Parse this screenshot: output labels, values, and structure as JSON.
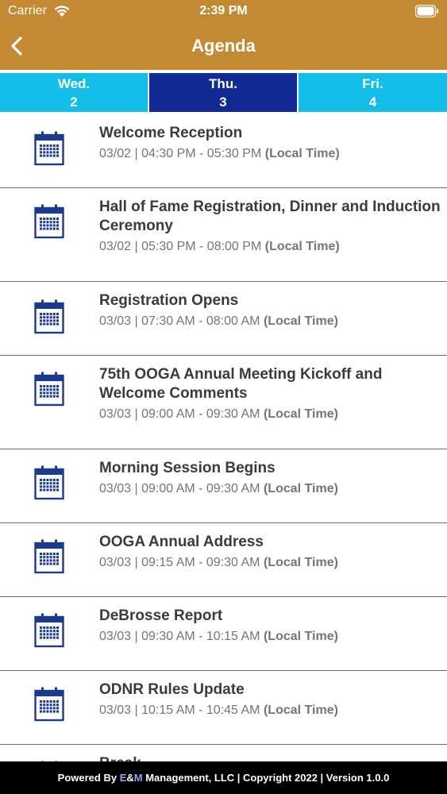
{
  "status": {
    "carrier": "Carrier",
    "time": "2:39 PM"
  },
  "nav": {
    "title": "Agenda",
    "back_icon": "chevron-left-icon"
  },
  "colors": {
    "header": "#c48a33",
    "tab_inactive": "#12bde8",
    "tab_active": "#102b96",
    "calendar_icon": "#1c3a8f"
  },
  "tabs": [
    {
      "day": "Wed.",
      "date": "2"
    },
    {
      "day": "Thu.",
      "date": "3"
    },
    {
      "day": "Fri.",
      "date": "4"
    }
  ],
  "items": [
    {
      "title": "Welcome Reception",
      "time": "03/02 | 04:30 PM - 05:30 PM",
      "zone": "(Local Time)"
    },
    {
      "title": "Hall of Fame Registration, Dinner and Induction Ceremony",
      "time": "03/02 | 05:30 PM - 08:00 PM",
      "zone": "(Local Time)"
    },
    {
      "title": "Registration Opens",
      "time": "03/03 | 07:30 AM - 08:00 AM",
      "zone": "(Local Time)"
    },
    {
      "title": "75th OOGA Annual Meeting Kickoff and Welcome Comments",
      "time": "03/03 | 09:00 AM - 09:30 AM",
      "zone": "(Local Time)"
    },
    {
      "title": "Morning Session Begins",
      "time": "03/03 | 09:00 AM - 09:30 AM",
      "zone": "(Local Time)"
    },
    {
      "title": "OOGA Annual Address",
      "time": "03/03 | 09:15 AM - 09:30 AM",
      "zone": "(Local Time)"
    },
    {
      "title": "DeBrosse Report",
      "time": "03/03 | 09:30 AM - 10:15 AM",
      "zone": "(Local Time)"
    },
    {
      "title": "ODNR Rules Update",
      "time": "03/03 | 10:15 AM - 10:45 AM",
      "zone": "(Local Time)"
    },
    {
      "title": "Break",
      "time": "",
      "zone": ""
    }
  ],
  "footer": {
    "prefix": "Powered By ",
    "e": "E",
    "amp": "&",
    "m": "M",
    "suffix": " Management, LLC | Copyright 2022 | Version 1.0.0"
  }
}
